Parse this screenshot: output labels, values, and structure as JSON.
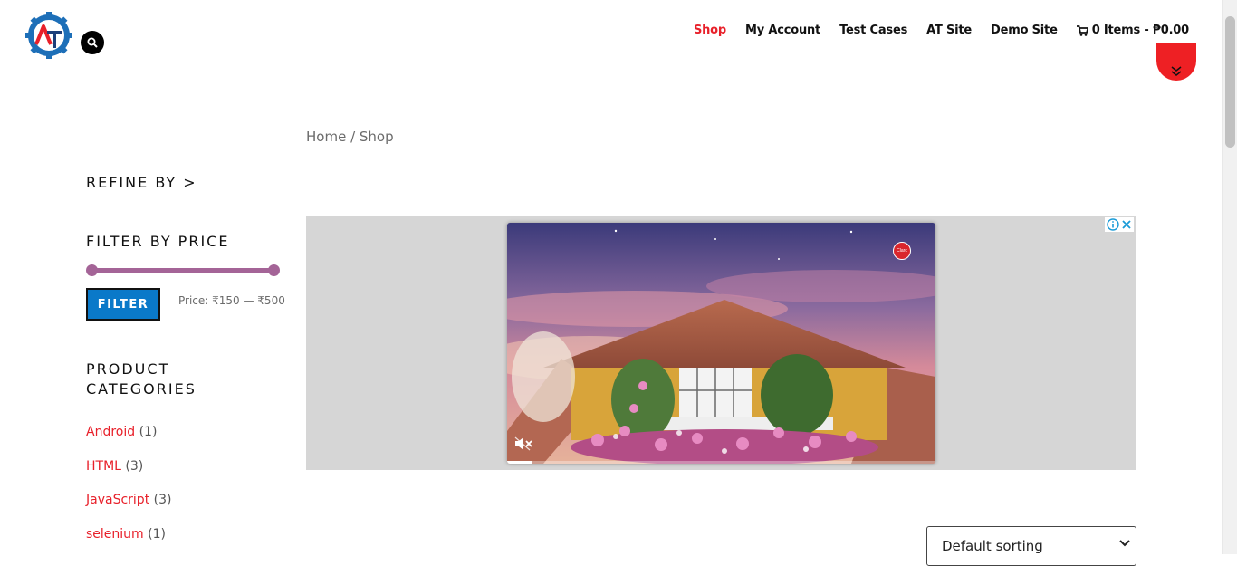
{
  "header": {
    "nav": [
      {
        "label": "Shop",
        "active": true
      },
      {
        "label": "My Account",
        "active": false
      },
      {
        "label": "Test Cases",
        "active": false
      },
      {
        "label": "AT Site",
        "active": false
      },
      {
        "label": "Demo Site",
        "active": false
      }
    ],
    "cart_label": "0 Items - ₱0.00"
  },
  "breadcrumb": {
    "home": "Home",
    "separator": " / ",
    "current": "Shop"
  },
  "sidebar": {
    "refine_by": "REFINE BY >",
    "filter_heading": "FILTER BY PRICE",
    "filter_button": "FILTER",
    "price_label": "Price: ₹150 — ₹500",
    "price_range": {
      "min": 150,
      "max": 500
    },
    "categories_heading": "PRODUCT CATEGORIES",
    "categories": [
      {
        "name": "Android",
        "count": "(1)"
      },
      {
        "name": "HTML",
        "count": "(3)"
      },
      {
        "name": "JavaScript",
        "count": "(3)"
      },
      {
        "name": "selenium",
        "count": "(1)"
      }
    ]
  },
  "ad": {
    "badge_text": "Clarc",
    "video_progress": 0.06
  },
  "sorting": {
    "selected": "Default sorting"
  },
  "colors": {
    "accent_red": "#e8202a",
    "slider_purple": "#a46497",
    "filter_blue": "#0a79c9"
  }
}
